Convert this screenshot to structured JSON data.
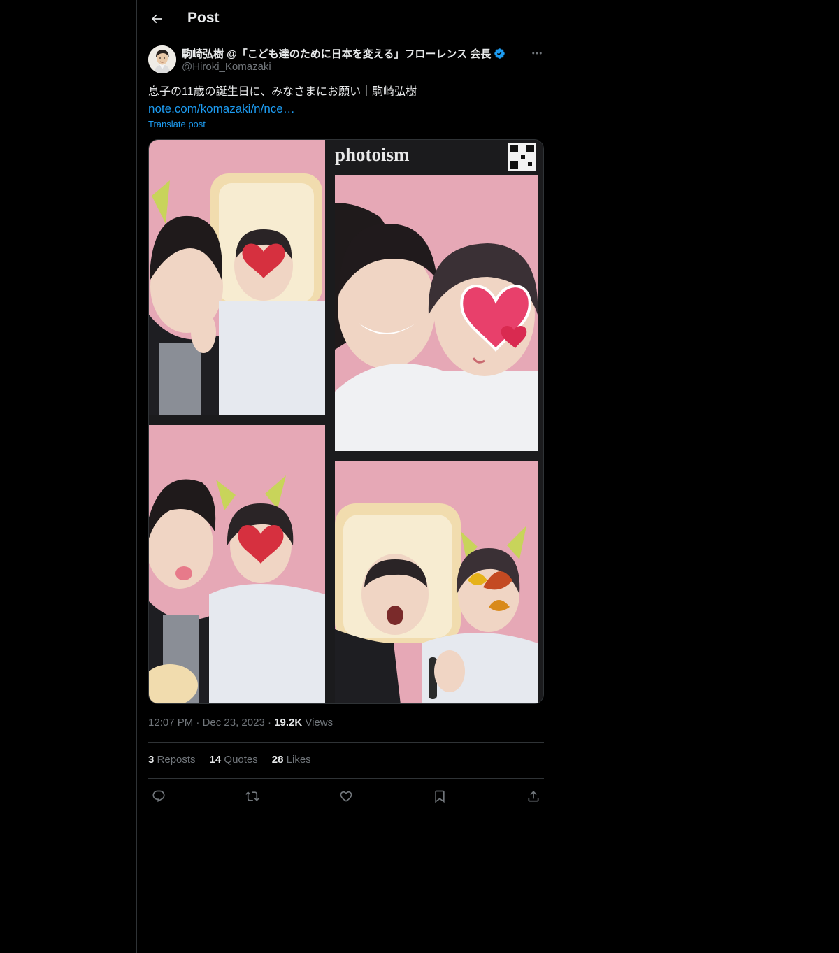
{
  "header": {
    "title": "Post"
  },
  "post": {
    "author_name": "駒崎弘樹 @「こども達のために日本を変える」フローレンス 会長",
    "author_handle": "@Hiroki_Komazaki",
    "text": "息子の11歳の誕生日に、みなさまにお願い｜駒崎弘樹",
    "link": "note.com/komazaki/n/nce…",
    "translate": "Translate post",
    "media_brand": "photoism",
    "time": "12:07 PM",
    "date": "Dec 23, 2023",
    "views_count": "19.2K",
    "views_label": "Views",
    "reposts_count": "3",
    "reposts_label": "Reposts",
    "quotes_count": "14",
    "quotes_label": "Quotes",
    "likes_count": "28",
    "likes_label": "Likes"
  },
  "icons": {
    "back": "arrow-left-icon",
    "more": "more-horizontal-icon",
    "verified": "verified-badge-icon",
    "reply": "reply-icon",
    "repost": "repost-icon",
    "like": "heart-icon",
    "bookmark": "bookmark-icon",
    "share": "share-icon"
  },
  "colors": {
    "background": "#000000",
    "text": "#e7e9ea",
    "muted": "#71767b",
    "accent": "#1d9bf0",
    "border": "#2f3336",
    "photo_background": "#e8a9b8"
  }
}
